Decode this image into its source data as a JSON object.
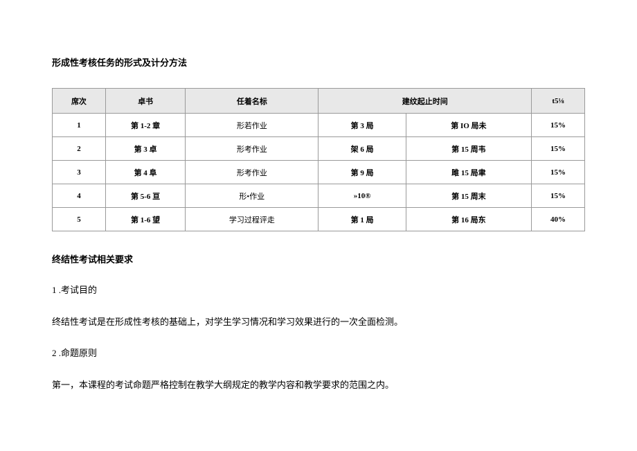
{
  "title1": "形成性考核任务的形式及计分方法",
  "headers": {
    "h1": "席次",
    "h2": "卓书",
    "h3": "任着名标",
    "h4": "建纹起止时间",
    "h5": "t5⅛"
  },
  "rows": [
    {
      "c1": "1",
      "c2": "第 1-2 章",
      "c3": "形若作业",
      "c4": "第 3 局",
      "c5": "第 IO 局未",
      "c6": "15%"
    },
    {
      "c1": "2",
      "c2": "第 3 卓",
      "c3": "形考作业",
      "c4": "架 6 局",
      "c5": "第 15 周韦",
      "c6": "15%"
    },
    {
      "c1": "3",
      "c2": "第 4 阜",
      "c3": "形考作业",
      "c4": "第 9 局",
      "c5": "雎 15 局聿",
      "c6": "15%"
    },
    {
      "c1": "4",
      "c2": "第 5-6 亘",
      "c3": "形•作业",
      "c4": "»10®",
      "c5": "第 15 周末",
      "c6": "15%"
    },
    {
      "c1": "5",
      "c2": "第 1-6 望",
      "c3": "学习过程评走",
      "c4": "第 1 局",
      "c5": "第 16 局东",
      "c6": "40%"
    }
  ],
  "title2": "终结性考试相关要求",
  "p1": "1 .考试目的",
  "p2": "终结性考试是在形成性考核的基础上，对学生学习情况和学习效果进行的一次全面检测。",
  "p3": "2 .命题原则",
  "p4": "第一，本课程的考试命题严格控制在教学大纲规定的教学内容和教学要求的范围之内。"
}
